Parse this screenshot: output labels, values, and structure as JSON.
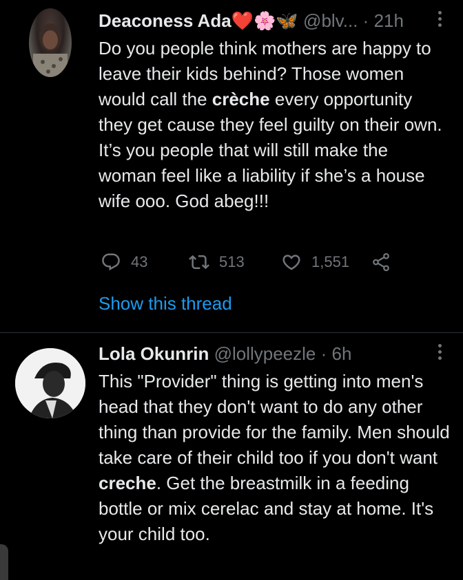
{
  "tweets": [
    {
      "author_name": "Deaconess Ada",
      "author_emojis": "❤️🌸🦋",
      "handle": "@blv...",
      "separator": "·",
      "time": "21h",
      "text_before": "Do you people think mothers are happy to leave their kids behind? Those women would call the ",
      "text_bold": "crèche",
      "text_after": " every opportunity they get cause they feel guilty on their own. It’s you people that will still make the woman feel like a liability if she’s a house wife ooo. God abeg!!!",
      "replies": "43",
      "retweets": "513",
      "likes": "1,551",
      "show_thread": "Show this thread"
    },
    {
      "author_name": "Lola Okunrin",
      "handle": "@lollypeezle",
      "separator": "·",
      "time": "6h",
      "text_before": "This  \"Provider\" thing is getting into men's head that they don't want to do any other thing than provide for the family. Men should take care of their child too if you don't want ",
      "text_bold": "creche",
      "text_after": ". Get the breastmilk in a feeding bottle or mix cerelac and stay at home. It's your child too."
    }
  ],
  "colors": {
    "background": "#000000",
    "text": "#e7e9ea",
    "muted": "#71767b",
    "link": "#1d9bf0",
    "divider": "#2f3336"
  },
  "icons": [
    "reply-icon",
    "retweet-icon",
    "like-icon",
    "share-icon",
    "more-icon"
  ]
}
